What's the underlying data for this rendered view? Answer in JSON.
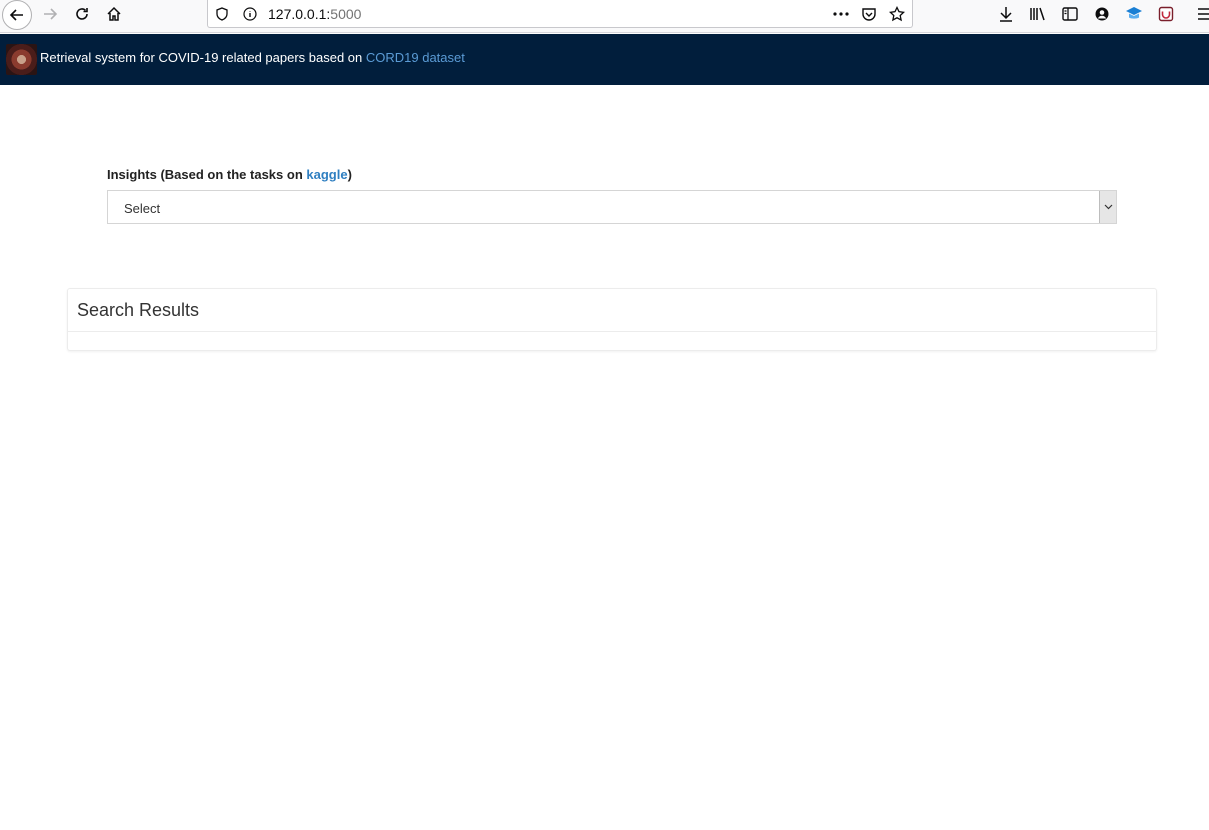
{
  "browser": {
    "url_host": "127.0.0.1:",
    "url_port": "5000",
    "icons": [
      "back-icon",
      "forward-icon",
      "reload-icon",
      "home-icon",
      "shield-icon",
      "info-icon",
      "more-icon",
      "pocket-icon",
      "bookmark-star-icon",
      "download-icon",
      "library-icon",
      "sidebar-icon",
      "account-icon",
      "extension-icon",
      "addon-icon",
      "menu-icon"
    ]
  },
  "header": {
    "title_prefix": "Retrieval system for COVID-19 related papers based on ",
    "link_text": "CORD19 dataset",
    "background": "#011e3c",
    "link_color": "#5b9bd5"
  },
  "insights": {
    "label_prefix": "Insights (Based on the tasks on ",
    "label_link": "kaggle",
    "label_suffix": ")",
    "select_value": "Select"
  },
  "results": {
    "title": "Search Results"
  }
}
